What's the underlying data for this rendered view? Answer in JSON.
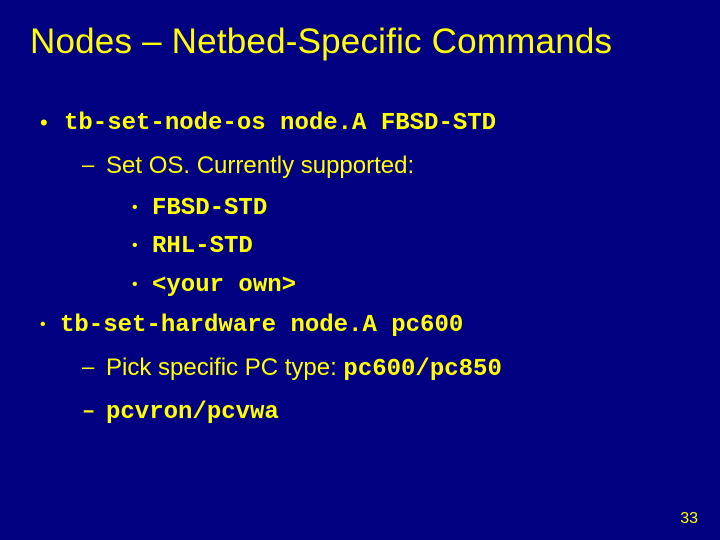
{
  "title": "Nodes – Netbed-Specific Commands",
  "items": {
    "b0": {
      "bullet": "•",
      "cmd": "tb-set-node-os node.A FBSD-STD"
    },
    "b0a": {
      "bullet": "–",
      "text": "Set OS. Currently supported:"
    },
    "b0a1": {
      "bullet": "•",
      "code": "FBSD-STD"
    },
    "b0a2": {
      "bullet": "•",
      "code": "RHL-STD"
    },
    "b0a3": {
      "bullet": "•",
      "code": "<your own>"
    },
    "b1": {
      "bullet": "•",
      "cmd": "tb-set-hardware node.A pc600"
    },
    "b1a": {
      "bullet": "–",
      "text_pre": "Pick specific PC type: ",
      "code": "pc600/pc850"
    },
    "b1b": {
      "bullet": "–",
      "code": "pcvron/pcvwa"
    }
  },
  "pagenum": "33"
}
